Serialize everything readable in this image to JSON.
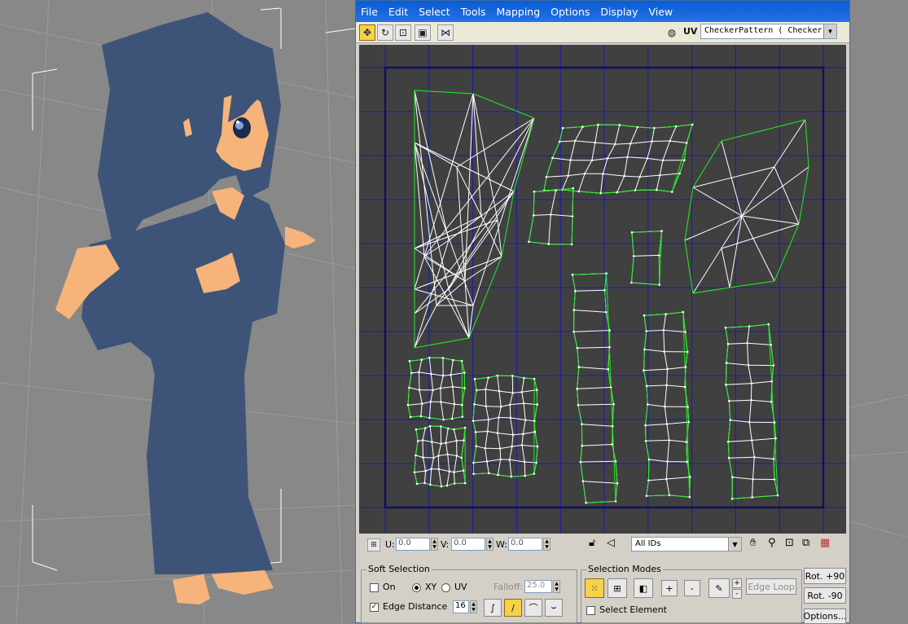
{
  "menu": [
    "File",
    "Edit",
    "Select",
    "Tools",
    "Mapping",
    "Options",
    "Display",
    "View"
  ],
  "toolbar": {
    "tools": [
      "move-icon",
      "rotate-icon",
      "scale-icon",
      "freeform-icon",
      "mirror-icon"
    ],
    "uv_label": "UV",
    "map_select": "CheckerPattern  ( Checker )"
  },
  "status": {
    "u_label": "U:",
    "u_value": "0.0",
    "v_label": "V:",
    "v_value": "0.0",
    "w_label": "W:",
    "w_value": "0.0",
    "id_select": "All IDs"
  },
  "soft_selection": {
    "title": "Soft Selection",
    "on_label": "On",
    "xy_label": "XY",
    "uv_label": "UV",
    "falloff_label": "Falloff:",
    "falloff_value": "25.0",
    "edge_distance_label": "Edge Distance",
    "edge_distance_checked": "✓",
    "edge_distance_value": "16"
  },
  "selection_modes": {
    "title": "Selection Modes",
    "plus": "+",
    "minus": "-",
    "edge_loop": "Edge Loop",
    "select_element": "Select Element"
  },
  "rotate": {
    "plus90": "Rot. +90",
    "minus90": "Rot. -90",
    "options": "Options..."
  },
  "colors": {
    "menubar": "#0a5bd4",
    "uv_edge": "#ffffff",
    "uv_border": "#22ee22",
    "grid": "#1a1aaa",
    "character": "#3d5478",
    "skin": "#f6b47a"
  }
}
